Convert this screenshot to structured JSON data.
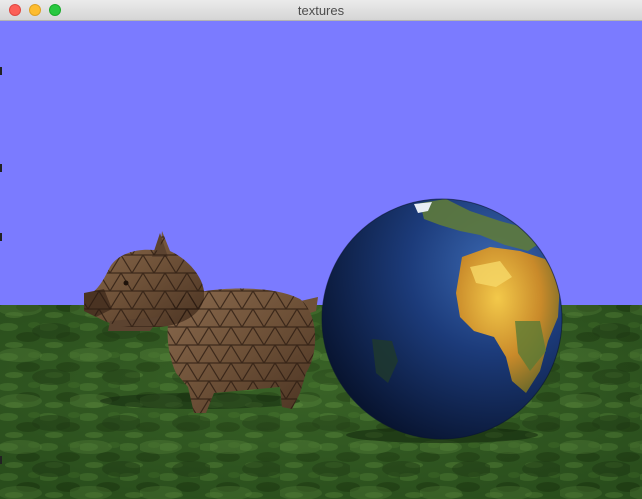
{
  "window": {
    "title": "textures",
    "controls": [
      "close",
      "minimize",
      "zoom"
    ]
  },
  "scene": {
    "sky_color": "#7b7bff",
    "ground_color": "#2f5a1f",
    "objects": [
      {
        "name": "dog",
        "texture": "wood-triangle-mesh"
      },
      {
        "name": "globe",
        "texture": "earth"
      }
    ]
  }
}
